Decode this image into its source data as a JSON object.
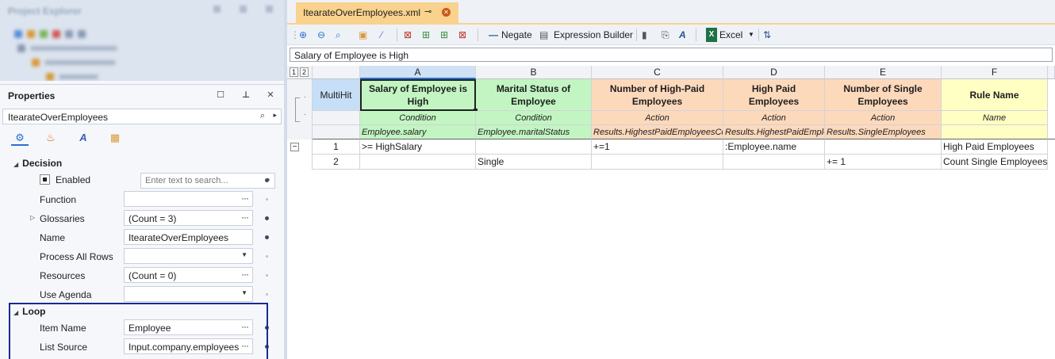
{
  "explorer": {
    "title": "Project Explorer"
  },
  "properties": {
    "title": "Properties",
    "object": "ItearateOverEmployees",
    "search_placeholder": "Enter text to search...",
    "categories": {
      "decision": "Decision",
      "loop": "Loop"
    },
    "rows": {
      "enabled": "Enabled",
      "function": {
        "label": "Function",
        "value": ""
      },
      "glossaries": {
        "label": "Glossaries",
        "value": "(Count = 3)"
      },
      "name": {
        "label": "Name",
        "value": "ItearateOverEmployees"
      },
      "process_all_rows": {
        "label": "Process All Rows",
        "value": ""
      },
      "resources": {
        "label": "Resources",
        "value": "(Count = 0)"
      },
      "use_agenda": {
        "label": "Use Agenda",
        "value": ""
      },
      "item_name": {
        "label": "Item Name",
        "value": "Employee"
      },
      "list_source": {
        "label": "List Source",
        "value": "Input.company.employees"
      }
    }
  },
  "tab": {
    "title": "ItearateOverEmployees.xml"
  },
  "toolbar": {
    "negate": "Negate",
    "expression_builder": "Expression Builder",
    "excel": "Excel"
  },
  "formula_bar": "Salary of Employee is High",
  "grid": {
    "levels": [
      "1",
      "2"
    ],
    "hit_policy": "MultiHit",
    "columns": [
      {
        "letter": "A",
        "header": "Salary of Employee is High",
        "type": "Condition",
        "expr": "Employee.salary"
      },
      {
        "letter": "B",
        "header": "Marital Status of Employee",
        "type": "Condition",
        "expr": "Employee.maritalStatus"
      },
      {
        "letter": "C",
        "header": "Number of High-Paid Employees",
        "type": "Action",
        "expr": "Results.HighestPaidEmployeesCount"
      },
      {
        "letter": "D",
        "header": "High Paid Employees",
        "type": "Action",
        "expr": "Results.HighestPaidEmployees"
      },
      {
        "letter": "E",
        "header": "Number of Single Employees",
        "type": "Action",
        "expr": "Results.SingleEmployees"
      },
      {
        "letter": "F",
        "header": "Rule Name",
        "type": "Name",
        "expr": ""
      }
    ],
    "rows": [
      {
        "num": "1",
        "cells": [
          ">= HighSalary",
          "",
          "+=1",
          ":Employee.name",
          "",
          "High Paid Employees"
        ]
      },
      {
        "num": "2",
        "cells": [
          "",
          "Single",
          "",
          "",
          "+= 1",
          "Count Single Employees"
        ]
      }
    ]
  }
}
